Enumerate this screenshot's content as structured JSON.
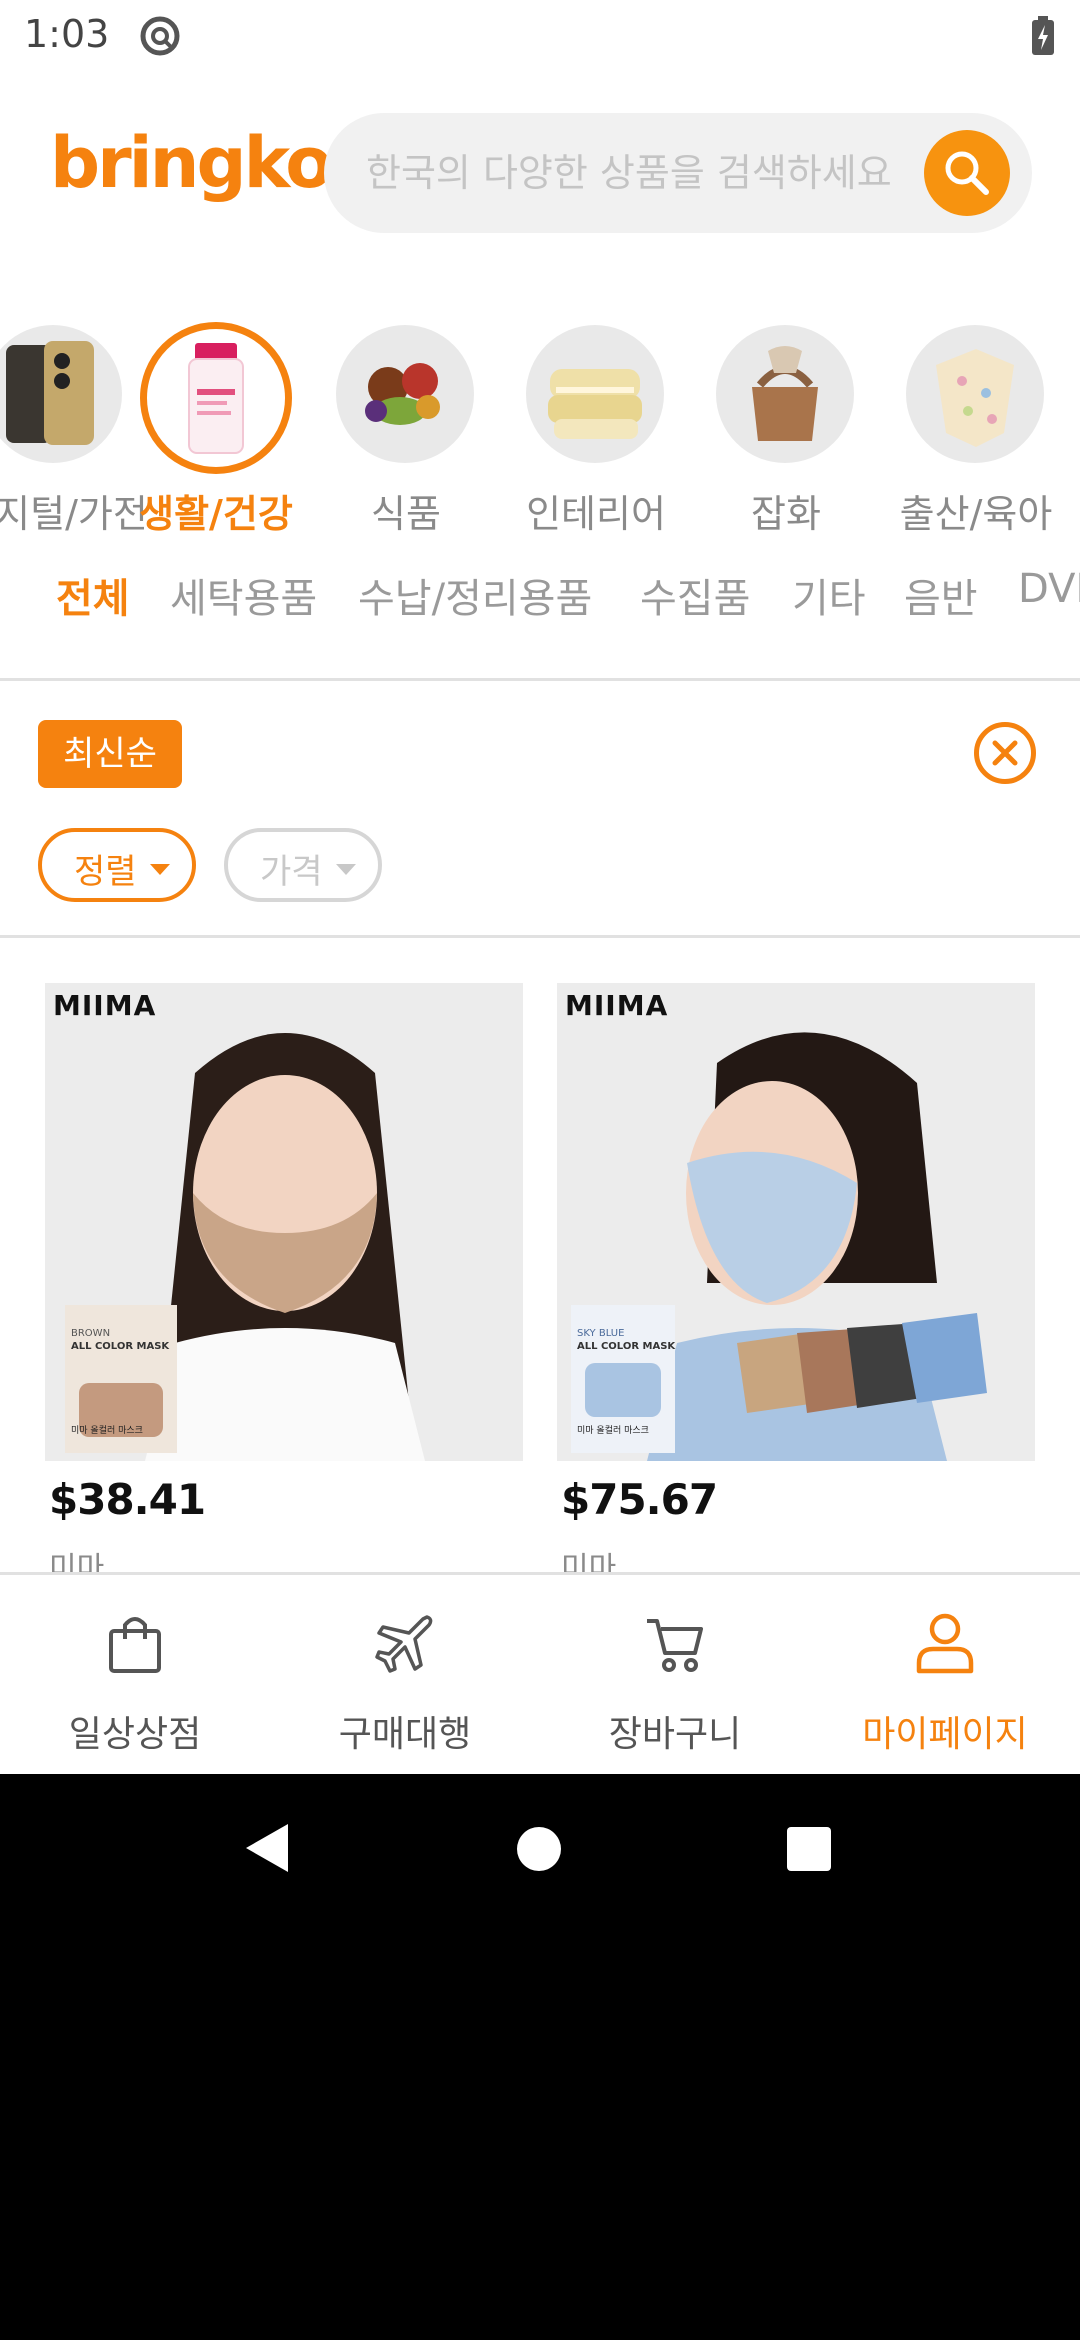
{
  "status_bar": {
    "time": "1:03"
  },
  "header": {
    "logo": "bringko",
    "search_placeholder": "한국의 다양한 상품을 검색하세요"
  },
  "categories": [
    {
      "label": "디지털/가전",
      "icon": "phone-image",
      "active": false
    },
    {
      "label": "생활/건강",
      "icon": "supplement-bottle-image",
      "active": true
    },
    {
      "label": "식품",
      "icon": "vegetables-image",
      "active": false
    },
    {
      "label": "인테리어",
      "icon": "bedding-image",
      "active": false
    },
    {
      "label": "잡화",
      "icon": "handbag-image",
      "active": false
    },
    {
      "label": "출산/육아",
      "icon": "baby-clothes-image",
      "active": false
    }
  ],
  "subtabs": [
    "전체",
    "세탁용품",
    "수납/정리용품",
    "수집품",
    "기타",
    "음반",
    "DVD"
  ],
  "filters": {
    "sort_chip": "최신순",
    "sort_dropdown": "정렬",
    "price_dropdown": "가격"
  },
  "products": [
    {
      "brand_logo": "MIIMA",
      "price": "$38.41",
      "brand": "미마",
      "image": "woman-beige-mask-photo",
      "pack_line1": "BROWN",
      "pack_line2": "ALL COLOR MASK",
      "pack_text": "미마 올컬러 마스크"
    },
    {
      "brand_logo": "MIIMA",
      "price": "$75.67",
      "brand": "미마",
      "image": "woman-blue-mask-photo",
      "pack_line1": "SKY BLUE",
      "pack_line2": "ALL COLOR MASK",
      "pack_text": "미마 올컬러 마스크"
    }
  ],
  "bottom_nav": [
    {
      "label": "일상상점",
      "icon": "shopping-bag-icon",
      "active": false
    },
    {
      "label": "구매대행",
      "icon": "airplane-icon",
      "active": false
    },
    {
      "label": "장바구니",
      "icon": "cart-icon",
      "active": false
    },
    {
      "label": "마이페이지",
      "icon": "user-icon",
      "active": true
    }
  ],
  "colors": {
    "accent": "#f5820f",
    "search_button": "#f7930f",
    "muted": "#9a9a9a"
  }
}
